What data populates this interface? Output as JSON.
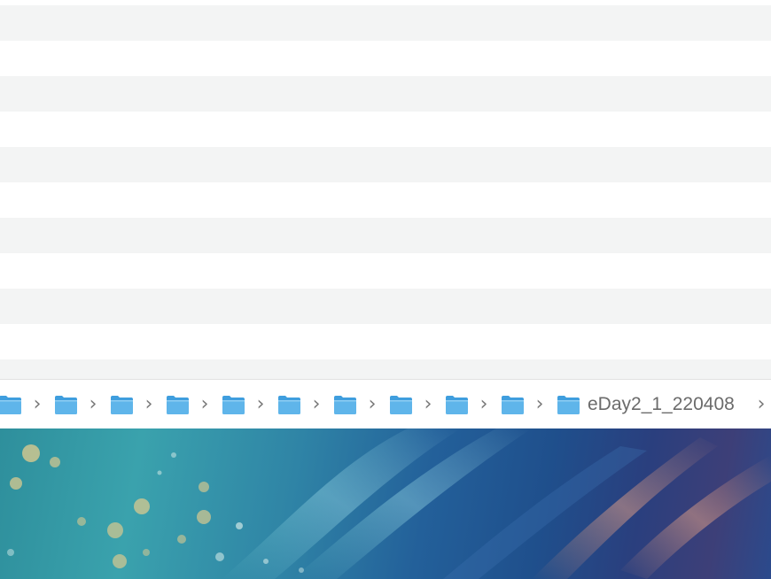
{
  "pathbar": {
    "segments": [
      {
        "icon": "folder-icon",
        "label": ""
      },
      {
        "icon": "folder-icon",
        "label": ""
      },
      {
        "icon": "folder-icon",
        "label": ""
      },
      {
        "icon": "folder-icon",
        "label": ""
      },
      {
        "icon": "folder-icon",
        "label": ""
      },
      {
        "icon": "folder-icon",
        "label": ""
      },
      {
        "icon": "folder-icon",
        "label": ""
      },
      {
        "icon": "folder-icon",
        "label": ""
      },
      {
        "icon": "folder-icon",
        "label": ""
      },
      {
        "icon": "folder-icon",
        "label": ""
      },
      {
        "icon": "folder-icon",
        "label": "eDay2_1_220408"
      }
    ],
    "separator": "›"
  },
  "colors": {
    "row_alt": "#f3f4f4",
    "folder_body": "#5fb5ea",
    "folder_tab": "#3f9ede"
  }
}
